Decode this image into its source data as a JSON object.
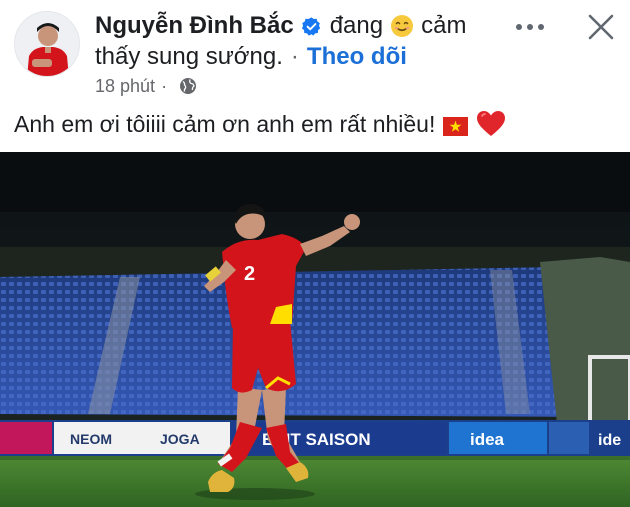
{
  "post": {
    "author_name": "Nguyễn Đình Bắc",
    "feeling_prefix": "đang",
    "feeling_text": "cảm",
    "feeling_text_line2": "thấy sung sướng.",
    "separator": "·",
    "follow_label": "Theo dõi",
    "timestamp": "18 phút",
    "meta_separator": "·",
    "privacy_icon": "globe-icon",
    "verified_icon": "verified-badge-icon",
    "feeling_icon": "smiling-face-icon",
    "body_text": "Anh em ơi tôiiii cảm ơn anh em rất nhiều!",
    "body_emojis": [
      "vietnam-flag-icon",
      "red-heart-icon"
    ]
  },
  "controls": {
    "more_icon": "more-options-icon",
    "close_icon": "close-icon"
  },
  "photo": {
    "description_icon": "post-photo",
    "jersey_number": "2",
    "board_texts": [
      "NEOM",
      "JOGA",
      "EDIT SAISON",
      "idea",
      "ide"
    ]
  },
  "colors": {
    "follow": "#1b6fd6",
    "verified": "#1877f2",
    "secondary_text": "#65676b",
    "kit_red": "#d3141b",
    "stand_blue": "#2b4fa8",
    "pitch_green": "#3e7a2e"
  }
}
